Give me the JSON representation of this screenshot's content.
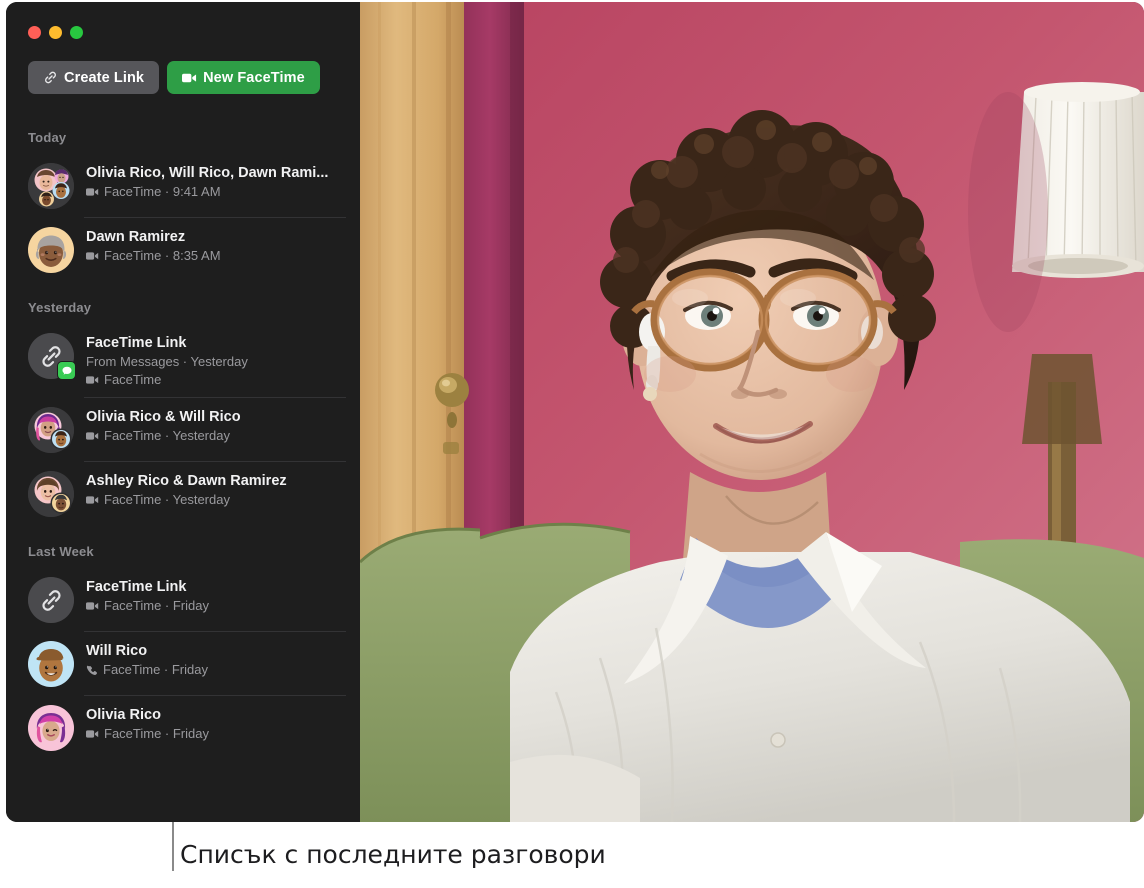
{
  "window": {
    "traffic_lights": [
      {
        "name": "close",
        "color": "#ff5f57"
      },
      {
        "name": "minimize",
        "color": "#febc2e"
      },
      {
        "name": "zoom",
        "color": "#28c840"
      }
    ]
  },
  "toolbar": {
    "create_link_label": "Create Link",
    "create_link_icon": "link-icon",
    "new_facetime_label": "New FaceTime",
    "new_facetime_icon": "video-camera-icon",
    "secondary_color": "#56565a",
    "primary_color": "#2e9e46"
  },
  "sidebar": {
    "groups": [
      {
        "header": "Today",
        "rows": [
          {
            "title": "Olivia Rico, Will Rico, Dawn Rami...",
            "subtitle": "FaceTime · 9:41 AM",
            "call_icon": "video-camera-icon",
            "avatar": "group-4"
          },
          {
            "title": "Dawn Ramirez",
            "subtitle": "FaceTime · 8:35 AM",
            "call_icon": "video-camera-icon",
            "avatar": "memoji-dawn"
          }
        ]
      },
      {
        "header": "Yesterday",
        "rows": [
          {
            "title": "FaceTime Link",
            "source": "From Messages · Yesterday",
            "subtitle": "FaceTime",
            "call_icon": "video-camera-icon",
            "avatar": "link-messages"
          },
          {
            "title": "Olivia Rico & Will Rico",
            "subtitle": "FaceTime · Yesterday",
            "call_icon": "video-camera-icon",
            "avatar": "pair-olivia-will"
          },
          {
            "title": "Ashley Rico & Dawn Ramirez",
            "subtitle": "FaceTime · Yesterday",
            "call_icon": "video-camera-icon",
            "avatar": "pair-ashley-dawn"
          }
        ]
      },
      {
        "header": "Last Week",
        "rows": [
          {
            "title": "FaceTime Link",
            "subtitle": "FaceTime · Friday",
            "call_icon": "video-camera-icon",
            "avatar": "link"
          },
          {
            "title": "Will Rico",
            "subtitle": "FaceTime · Friday",
            "call_icon": "phone-icon",
            "avatar": "memoji-will"
          },
          {
            "title": "Olivia Rico",
            "subtitle": "FaceTime · Friday",
            "call_icon": "video-camera-icon",
            "avatar": "memoji-olivia"
          }
        ]
      }
    ]
  },
  "video": {
    "description": "Live FaceTime video of a person with short curly brown hair, tortoiseshell glasses and AirPods, wearing a white short-sleeve shirt over a blue t-shirt, seated on a green sofa in front of a pink wall with a wooden door and a white lampshade.",
    "wall_color": "#c2566f",
    "door_color": "#d9ab6c",
    "sofa_color": "#8fa26a",
    "shirt_color": "#e9e7e1",
    "tee_color": "#7b8fc4"
  },
  "caption": {
    "text": "Списък с последните разговори"
  }
}
